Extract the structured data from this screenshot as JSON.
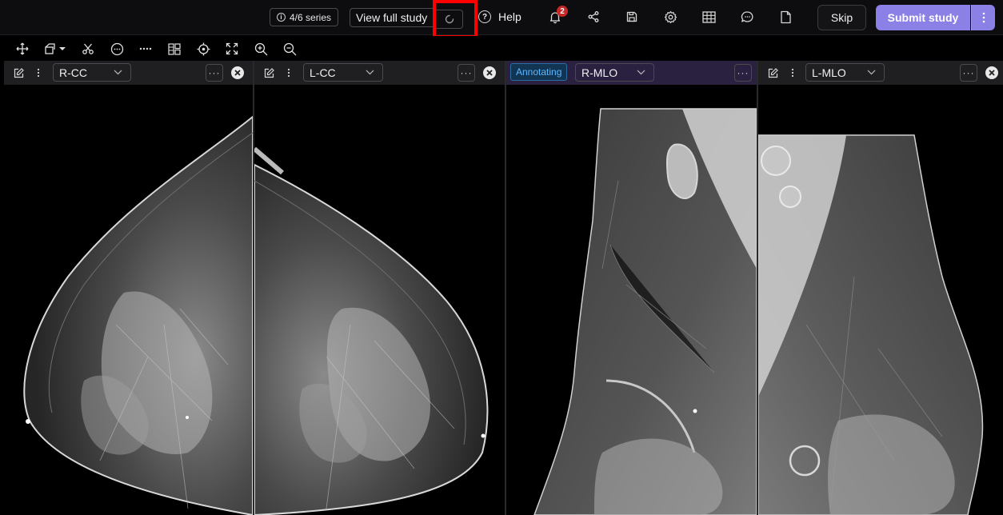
{
  "topbar": {
    "series_count": "4/6 series",
    "view_full_study": "View full study",
    "help_label": "Help",
    "notification_count": "2",
    "skip_label": "Skip",
    "submit_label": "Submit study"
  },
  "colors": {
    "accent": "#8b80e6",
    "highlight_box": "#ff0000",
    "annotating_bg": "#2a2140",
    "annotating_text": "#5db8ff",
    "badge": "#c62828"
  },
  "toolbar": {
    "tools": [
      "pan-icon",
      "rotate-icon",
      "scissors-icon",
      "comment-icon",
      "ellipsis-icon",
      "layout-icon",
      "crosshair-icon",
      "fit-icon",
      "zoom-in-icon",
      "zoom-out-icon"
    ]
  },
  "viewports": [
    {
      "view": "R-CC",
      "annotating": false
    },
    {
      "view": "L-CC",
      "annotating": false
    },
    {
      "view": "R-MLO",
      "annotating": true,
      "annotating_label": "Annotating"
    },
    {
      "view": "L-MLO",
      "annotating": false
    }
  ]
}
